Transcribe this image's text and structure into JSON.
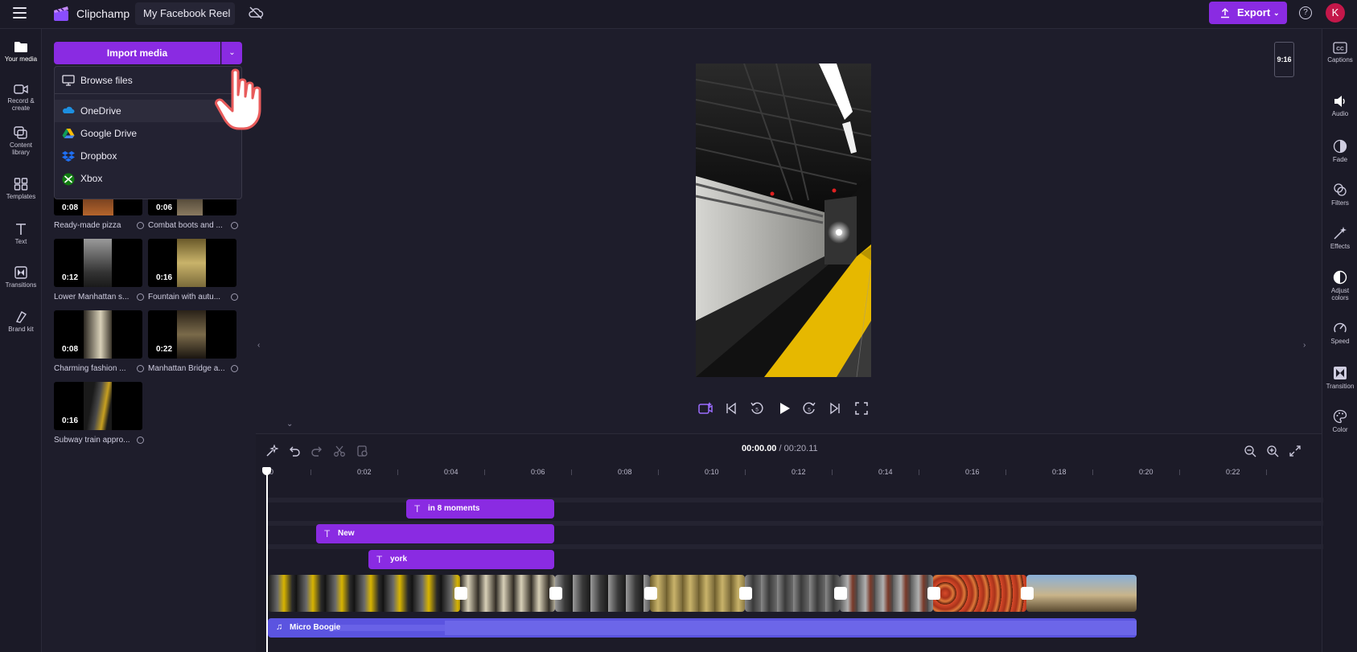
{
  "app": {
    "name": "Clipchamp",
    "project_title": "My Facebook Reel"
  },
  "header": {
    "export_label": "Export",
    "help_label": "?",
    "avatar_initial": "K"
  },
  "left_nav": {
    "items": [
      {
        "label": "Your media",
        "icon": "folder-icon"
      },
      {
        "label": "Record &",
        "label2": "create",
        "icon": "video-camera-icon"
      },
      {
        "label": "Content",
        "label2": "library",
        "icon": "content-library-icon"
      },
      {
        "label": "Templates",
        "icon": "templates-icon"
      },
      {
        "label": "Text",
        "icon": "text-icon"
      },
      {
        "label": "Transitions",
        "icon": "transitions-icon"
      },
      {
        "label": "Brand kit",
        "icon": "brand-kit-icon"
      }
    ]
  },
  "media_panel": {
    "import_label": "Import media",
    "dropdown": [
      {
        "label": "Browse files",
        "icon": "monitor-icon"
      },
      {
        "label": "OneDrive",
        "icon": "onedrive-icon"
      },
      {
        "label": "Google Drive",
        "icon": "google-drive-icon"
      },
      {
        "label": "Dropbox",
        "icon": "dropbox-icon"
      },
      {
        "label": "Xbox",
        "icon": "xbox-icon"
      }
    ],
    "clips": [
      {
        "duration": "0:08",
        "caption": "Ready-made pizza"
      },
      {
        "duration": "0:06",
        "caption": "Combat boots and ..."
      },
      {
        "duration": "0:12",
        "caption": "Lower Manhattan s..."
      },
      {
        "duration": "0:16",
        "caption": "Fountain with autu..."
      },
      {
        "duration": "0:08",
        "caption": "Charming fashion ..."
      },
      {
        "duration": "0:22",
        "caption": "Manhattan Bridge a..."
      },
      {
        "duration": "0:16",
        "caption": "Subway train appro..."
      }
    ]
  },
  "preview": {
    "aspect_ratio": "9:16"
  },
  "right_bar": {
    "items": [
      {
        "label": "Captions",
        "icon": "captions-icon"
      },
      {
        "label": "Audio",
        "icon": "speaker-icon"
      },
      {
        "label": "Fade",
        "icon": "fade-icon"
      },
      {
        "label": "Filters",
        "icon": "filters-icon"
      },
      {
        "label": "Effects",
        "icon": "effects-icon"
      },
      {
        "label": "Adjust",
        "label2": "colors",
        "icon": "adjust-colors-icon"
      },
      {
        "label": "Speed",
        "icon": "speed-icon"
      },
      {
        "label": "Transition",
        "icon": "transition-icon"
      },
      {
        "label": "Color",
        "icon": "color-palette-icon"
      }
    ]
  },
  "timeline": {
    "current_time": "00:00.00",
    "total_time": "/ 00:20.11",
    "ruler": [
      "0",
      "0:02",
      "0:04",
      "0:06",
      "0:08",
      "0:10",
      "0:12",
      "0:14",
      "0:16",
      "0:18",
      "0:20",
      "0:22"
    ],
    "text_clips": [
      {
        "label": "in 8 moments"
      },
      {
        "label": "New"
      },
      {
        "label": "york"
      }
    ],
    "audio_clip": {
      "label": "Micro Boogie"
    }
  },
  "colors": {
    "accent": "#8a2be2",
    "audio": "#5b54e0",
    "background": "#1e1d2b"
  }
}
